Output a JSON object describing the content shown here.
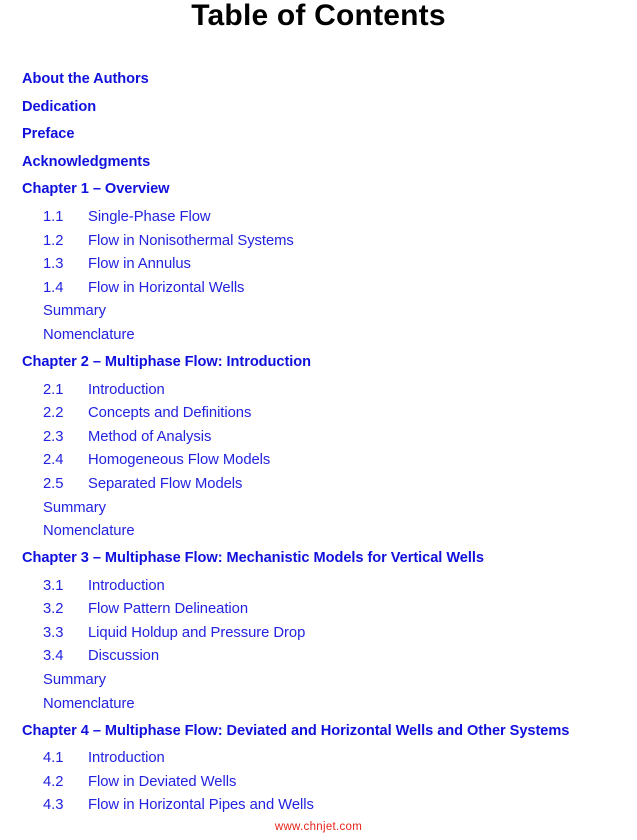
{
  "document": {
    "title": "Table of Contents",
    "watermark": "www.chnjet.com",
    "colors": {
      "title": "#000000",
      "heading_link": "#1111dd",
      "section_link": "#2222e0",
      "watermark": "#e8231a",
      "background": "#ffffff"
    }
  },
  "front_matter": [
    {
      "label": "About the Authors"
    },
    {
      "label": "Dedication"
    },
    {
      "label": "Preface"
    },
    {
      "label": "Acknowledgments"
    }
  ],
  "chapters": [
    {
      "heading": "Chapter 1 – Overview",
      "sections": [
        {
          "number": "1.1",
          "label": "Single-Phase Flow"
        },
        {
          "number": "1.2",
          "label": "Flow in Nonisothermal Systems"
        },
        {
          "number": "1.3",
          "label": "Flow in Annulus"
        },
        {
          "number": "1.4",
          "label": "Flow in Horizontal Wells"
        }
      ],
      "back_matter": [
        {
          "label": "Summary"
        },
        {
          "label": "Nomenclature"
        }
      ]
    },
    {
      "heading": "Chapter 2 – Multiphase Flow: Introduction",
      "sections": [
        {
          "number": "2.1",
          "label": "Introduction"
        },
        {
          "number": "2.2",
          "label": "Concepts and Definitions"
        },
        {
          "number": "2.3",
          "label": "Method of Analysis"
        },
        {
          "number": "2.4",
          "label": "Homogeneous Flow Models"
        },
        {
          "number": "2.5",
          "label": "Separated Flow Models"
        }
      ],
      "back_matter": [
        {
          "label": "Summary"
        },
        {
          "label": "Nomenclature"
        }
      ]
    },
    {
      "heading": "Chapter 3 – Multiphase Flow: Mechanistic Models for Vertical Wells",
      "sections": [
        {
          "number": "3.1",
          "label": "Introduction"
        },
        {
          "number": "3.2",
          "label": "Flow Pattern Delineation"
        },
        {
          "number": "3.3",
          "label": "Liquid Holdup and Pressure Drop"
        },
        {
          "number": "3.4",
          "label": "Discussion"
        }
      ],
      "back_matter": [
        {
          "label": "Summary"
        },
        {
          "label": "Nomenclature"
        }
      ]
    },
    {
      "heading": "Chapter 4 – Multiphase Flow: Deviated and Horizontal Wells and Other Systems",
      "sections": [
        {
          "number": "4.1",
          "label": "Introduction"
        },
        {
          "number": "4.2",
          "label": "Flow in Deviated Wells"
        },
        {
          "number": "4.3",
          "label": "Flow in Horizontal Pipes and Wells"
        }
      ],
      "back_matter": []
    }
  ]
}
